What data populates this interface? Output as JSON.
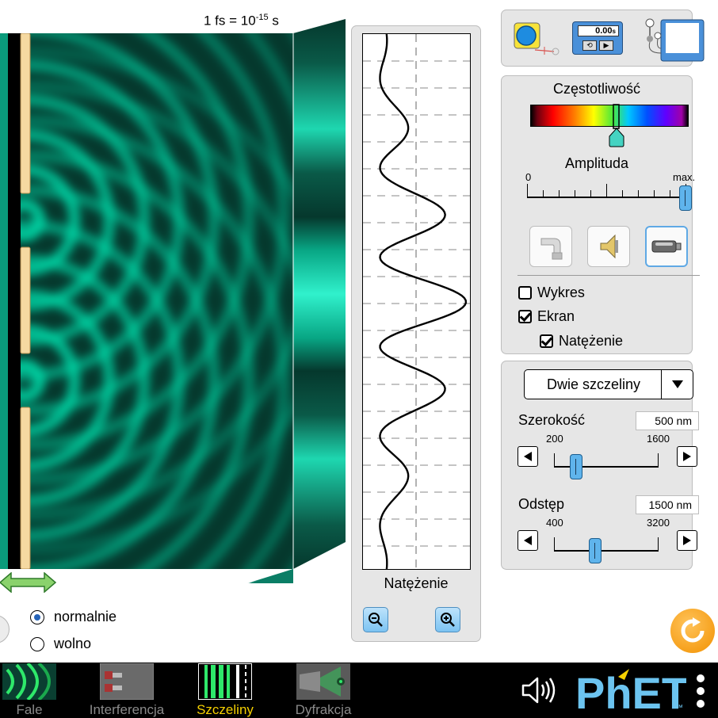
{
  "time_label": {
    "prefix": "1 fs = 10",
    "exponent": "-15",
    "suffix": " s"
  },
  "intensity_panel": {
    "label": "Natężenie"
  },
  "wave_panel": {
    "frequency_title": "Częstotliwość",
    "amplitude_title": "Amplituda",
    "amplitude_min": "0",
    "amplitude_max": "max.",
    "checkboxes": {
      "graph": "Wykres",
      "screen": "Ekran",
      "intensity": "Natężenie"
    },
    "graph_checked": false,
    "screen_checked": true,
    "intensity_checked": true
  },
  "slit_panel": {
    "combo_value": "Dwie szczeliny",
    "width": {
      "label": "Szerokość",
      "value": "500 nm",
      "min": "200",
      "max": "1600",
      "fraction": 0.214
    },
    "separation": {
      "label": "Odstęp",
      "value": "1500 nm",
      "min": "400",
      "max": "3200",
      "fraction": 0.393
    }
  },
  "stopwatch_readout": {
    "value": "0.00",
    "unit": "s"
  },
  "speed": {
    "normal": "normalnie",
    "slow": "wolno",
    "selected": "normalnie"
  },
  "nav": {
    "items": [
      {
        "label": "Fale",
        "active": false
      },
      {
        "label": "Interferencja",
        "active": false
      },
      {
        "label": "Szczeliny",
        "active": true
      },
      {
        "label": "Dyfrakcja",
        "active": false
      }
    ]
  },
  "colors": {
    "wave": "#00d9a8",
    "panel_bg": "#e6e6e6",
    "accent_blue": "#5fb4ec",
    "active_nav": "#f5d000",
    "phet_blue": "#6cc4f0",
    "reset_orange": "#f29100",
    "barrier": "#f5d9a1"
  }
}
